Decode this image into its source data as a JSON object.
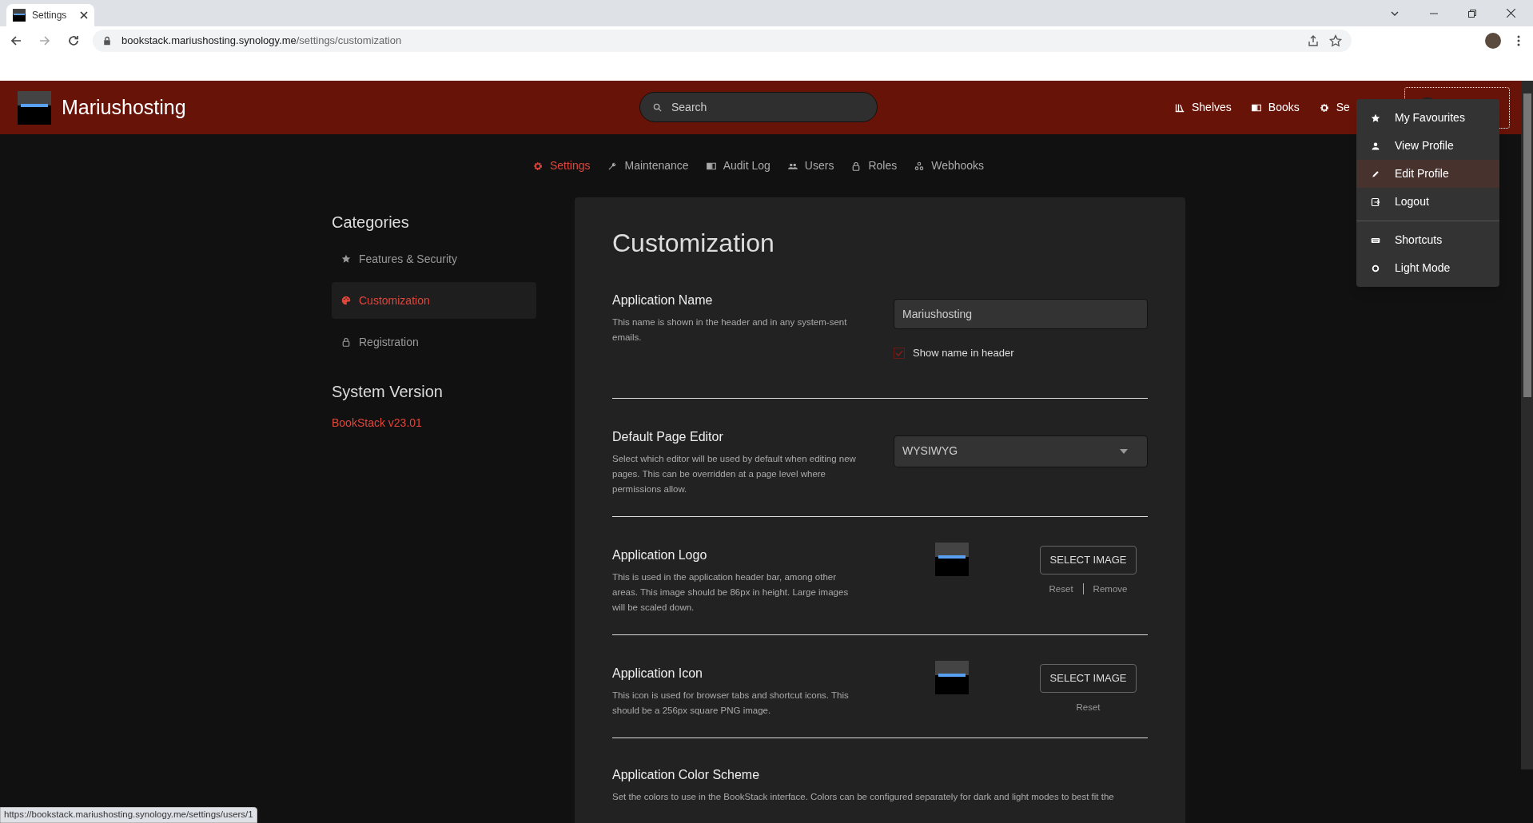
{
  "browser": {
    "tab_title": "Settings",
    "url_host": "bookstack.mariushosting.synology.me",
    "url_path": "/settings/customization"
  },
  "header": {
    "app_name": "Mariushosting",
    "search_placeholder": "Search",
    "nav": [
      {
        "label": "Shelves"
      },
      {
        "label": "Books"
      },
      {
        "label": "Se"
      }
    ]
  },
  "user_menu": {
    "groups": [
      {
        "items": [
          {
            "label": "My Favourites",
            "highlighted": false
          },
          {
            "label": "View Profile",
            "highlighted": false
          },
          {
            "label": "Edit Profile",
            "highlighted": true
          },
          {
            "label": "Logout",
            "highlighted": false
          }
        ]
      },
      {
        "items": [
          {
            "label": "Shortcuts",
            "highlighted": false
          },
          {
            "label": "Light Mode",
            "highlighted": false
          }
        ]
      }
    ]
  },
  "settings_tabs": [
    {
      "label": "Settings",
      "selected": true
    },
    {
      "label": "Maintenance",
      "selected": false
    },
    {
      "label": "Audit Log",
      "selected": false
    },
    {
      "label": "Users",
      "selected": false
    },
    {
      "label": "Roles",
      "selected": false
    },
    {
      "label": "Webhooks",
      "selected": false
    }
  ],
  "sidebar": {
    "heading": "Categories",
    "items": [
      {
        "label": "Features & Security",
        "selected": false
      },
      {
        "label": "Customization",
        "selected": true
      },
      {
        "label": "Registration",
        "selected": false
      }
    ],
    "version_heading": "System Version",
    "version": "BookStack v23.01"
  },
  "page": {
    "title": "Customization",
    "sections": [
      {
        "kind": "text",
        "label": "Application Name",
        "description": "This name is shown in the header and in any system-sent emails.",
        "value": "Mariushosting",
        "checkbox": {
          "label": "Show name in header",
          "checked": true
        }
      },
      {
        "kind": "select",
        "label": "Default Page Editor",
        "description": "Select which editor will be used by default when editing new pages. This can be overridden at a page level where permissions allow.",
        "value": "WYSIWYG"
      },
      {
        "kind": "image",
        "label": "Application Logo",
        "description": "This is used in the application header bar, among other areas. This image should be 86px in height. Large images will be scaled down.",
        "button": "SELECT IMAGE",
        "actions": [
          "Reset",
          "Remove"
        ]
      },
      {
        "kind": "image",
        "label": "Application Icon",
        "description": "This icon is used for browser tabs and shortcut icons. This should be a 256px square PNG image.",
        "button": "SELECT IMAGE",
        "actions": [
          "Reset"
        ]
      },
      {
        "kind": "heading",
        "label": "Application Color Scheme",
        "description": "Set the colors to use in the BookStack interface. Colors can be configured separately for dark and light modes to best fit the"
      }
    ]
  },
  "status_url": "https://bookstack.mariushosting.synology.me/settings/users/1"
}
